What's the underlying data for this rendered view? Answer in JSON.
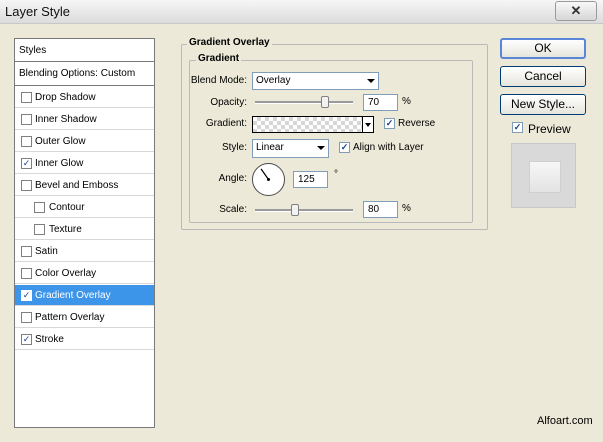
{
  "window": {
    "title": "Layer Style",
    "close_glyph": "✕"
  },
  "styles_panel": {
    "header": "Styles",
    "blending": "Blending Options: Custom",
    "items": [
      {
        "label": "Drop Shadow",
        "checked": false
      },
      {
        "label": "Inner Shadow",
        "checked": false
      },
      {
        "label": "Outer Glow",
        "checked": false
      },
      {
        "label": "Inner Glow",
        "checked": true
      },
      {
        "label": "Bevel and Emboss",
        "checked": false
      },
      {
        "label": "Contour",
        "checked": false,
        "indent": true
      },
      {
        "label": "Texture",
        "checked": false,
        "indent": true
      },
      {
        "label": "Satin",
        "checked": false
      },
      {
        "label": "Color Overlay",
        "checked": false
      },
      {
        "label": "Gradient Overlay",
        "checked": true,
        "selected": true
      },
      {
        "label": "Pattern Overlay",
        "checked": false
      },
      {
        "label": "Stroke",
        "checked": true
      }
    ]
  },
  "gradient_overlay": {
    "group_title": "Gradient Overlay",
    "subgroup_title": "Gradient",
    "blend_mode": {
      "label": "Blend Mode:",
      "value": "Overlay"
    },
    "opacity": {
      "label": "Opacity:",
      "value": "70",
      "unit": "%",
      "level": 0.7
    },
    "gradient": {
      "label": "Gradient:"
    },
    "reverse": {
      "label": "Reverse",
      "checked": true
    },
    "style": {
      "label": "Style:",
      "value": "Linear"
    },
    "align_with_layer": {
      "label": "Align with Layer",
      "checked": true
    },
    "angle": {
      "label": "Angle:",
      "value": "125",
      "unit": "°",
      "degrees": 125
    },
    "scale": {
      "label": "Scale:",
      "value": "80",
      "unit": "%",
      "level": 0.4
    }
  },
  "buttons": {
    "ok": "OK",
    "cancel": "Cancel",
    "new_style": "New Style..."
  },
  "preview": {
    "label": "Preview",
    "checked": true
  },
  "watermark": "Alfoart.com",
  "check_glyph": "✓"
}
